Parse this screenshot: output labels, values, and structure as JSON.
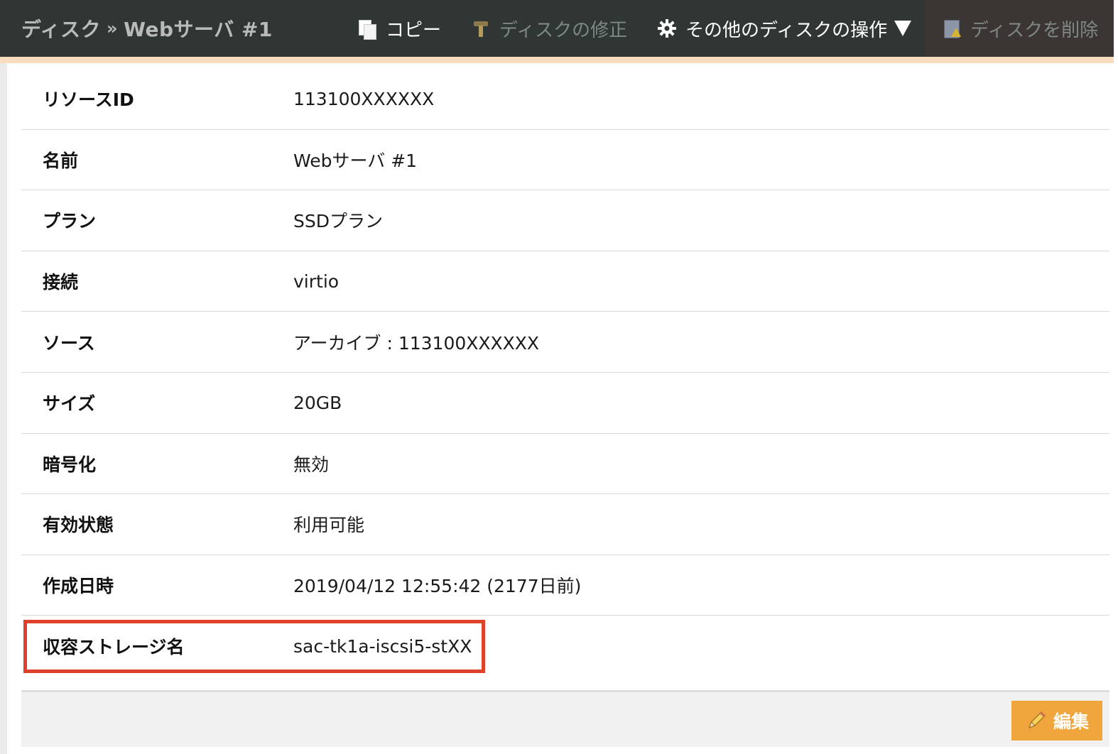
{
  "header": {
    "breadcrumb_root": "ディスク",
    "breadcrumb_sep": "»",
    "breadcrumb_current": "Webサーバ #1",
    "actions": {
      "copy": "コピー",
      "repair": "ディスクの修正",
      "other": "その他のディスクの操作",
      "delete": "ディスクを削除"
    }
  },
  "details": {
    "rows": [
      {
        "label": "リソースID",
        "value": "113100XXXXXX"
      },
      {
        "label": "名前",
        "value": "Webサーバ #1"
      },
      {
        "label": "プラン",
        "value": "SSDプラン"
      },
      {
        "label": "接続",
        "value": "virtio"
      },
      {
        "label": "ソース",
        "value": "アーカイブ : 113100XXXXXX"
      },
      {
        "label": "サイズ",
        "value": "20GB"
      },
      {
        "label": "暗号化",
        "value": "無効"
      },
      {
        "label": "有効状態",
        "value": "利用可能"
      },
      {
        "label": "作成日時",
        "value": "2019/04/12 12:55:42 (2177日前)"
      },
      {
        "label": "収容ストレージ名",
        "value": "sac-tk1a-iscsi5-stXX"
      }
    ]
  },
  "footer": {
    "edit_label": "編集"
  },
  "colors": {
    "header_bg": "#2f3633",
    "accent_strip": "#f7dcbd",
    "highlight": "#e0412c",
    "edit_button": "#f0a63c"
  },
  "icons": {
    "copy": "copy-icon",
    "repair": "hammer-icon",
    "other": "gear-icon",
    "delete": "delete-disk-icon",
    "edit": "pencil-icon"
  }
}
